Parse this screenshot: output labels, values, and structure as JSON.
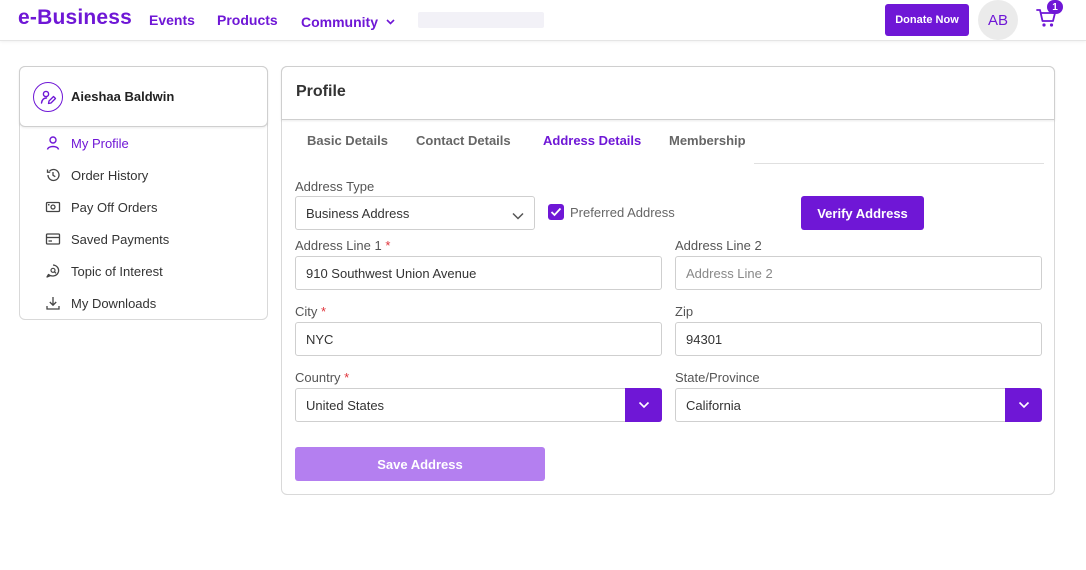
{
  "header": {
    "logo": "e-Business",
    "nav": {
      "events": "Events",
      "products": "Products",
      "community": "Community"
    },
    "donate_label": "Donate Now",
    "avatar_initials": "AB",
    "cart_count": "1"
  },
  "sidebar": {
    "user_name": "Aieshaa Baldwin",
    "items": [
      {
        "label": "My Profile",
        "icon": "person-icon",
        "active": true
      },
      {
        "label": "Order History",
        "icon": "history-icon"
      },
      {
        "label": "Pay Off Orders",
        "icon": "cash-icon"
      },
      {
        "label": "Saved Payments",
        "icon": "credit-card-icon"
      },
      {
        "label": "Topic of Interest",
        "icon": "chat-search-icon"
      },
      {
        "label": "My Downloads",
        "icon": "download-icon"
      }
    ]
  },
  "profile": {
    "title": "Profile",
    "tabs": [
      {
        "label": "Basic Details"
      },
      {
        "label": "Contact Details"
      },
      {
        "label": "Address Details",
        "active": true
      },
      {
        "label": "Membership"
      }
    ],
    "form": {
      "address_type_label": "Address Type",
      "address_type_value": "Business Address",
      "preferred_label": "Preferred Address",
      "preferred_checked": true,
      "verify_label": "Verify Address",
      "line1_label": "Address Line 1",
      "line1_value": "910 Southwest Union Avenue",
      "line2_label": "Address Line 2",
      "line2_placeholder": "Address Line 2",
      "city_label": "City",
      "city_value": "NYC",
      "zip_label": "Zip",
      "zip_value": "94301",
      "country_label": "Country",
      "country_value": "United States",
      "state_label": "State/Province",
      "state_value": "California",
      "required_mark": "*",
      "save_label": "Save Address"
    }
  },
  "colors": {
    "accent": "#6f17d6",
    "accent_light": "#b47ff0",
    "required": "#e0333a"
  }
}
